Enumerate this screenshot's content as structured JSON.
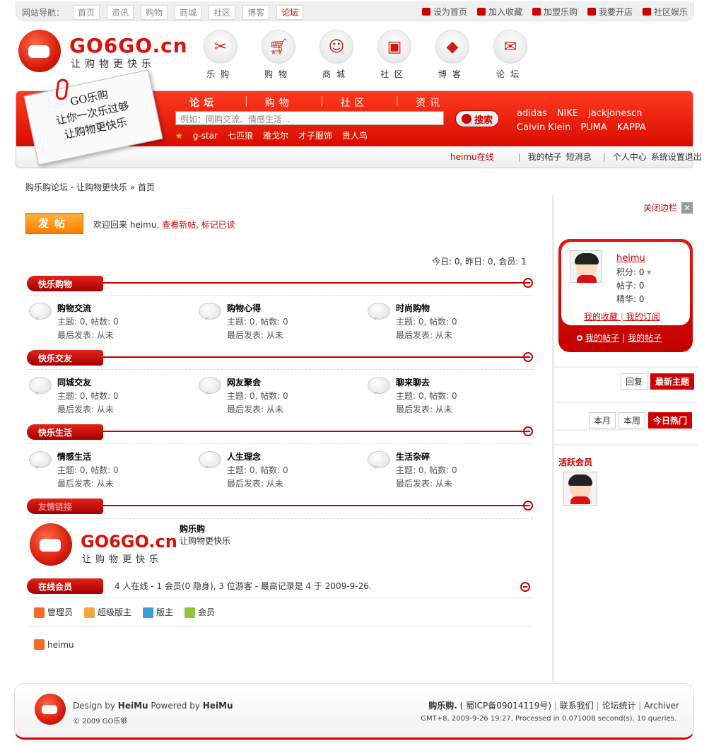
{
  "topbar": {
    "label": "网站导航：",
    "nav": [
      "首页",
      "资讯",
      "购物",
      "商城",
      "社区",
      "博客",
      "论坛"
    ],
    "active_index": 6,
    "quick": [
      "设为首页",
      "加入收藏",
      "加盟乐购",
      "我要开店",
      "社区娱乐"
    ]
  },
  "logo": {
    "text": "GO6GO.cn",
    "slogan": "让购物更快乐"
  },
  "main_icons": [
    {
      "label": "乐购",
      "icon": "scissors-icon"
    },
    {
      "label": "购物",
      "icon": "cart-icon"
    },
    {
      "label": "商城",
      "icon": "headset-icon"
    },
    {
      "label": "社区",
      "icon": "tv-icon"
    },
    {
      "label": "博客",
      "icon": "tag-icon"
    },
    {
      "label": "论坛",
      "icon": "chat-icon"
    }
  ],
  "note": {
    "line1": "GO乐购",
    "line2": "让你一次乐过够",
    "line3": "让购物更快乐"
  },
  "banner": {
    "tabs": [
      "论坛",
      "购物",
      "社区",
      "资讯"
    ],
    "search_placeholder": "例如：网购交流、情感生活...",
    "search_button": "搜索",
    "hot_words": [
      "g-star",
      "七匹狼",
      "雅戈尔",
      "才子服饰",
      "贵人鸟"
    ],
    "brands_row1": [
      "adidas",
      "NIKE",
      "jackjonescn"
    ],
    "brands_row2": [
      "Calvin Klein",
      "PUMA",
      "KAPPA"
    ]
  },
  "userbar": {
    "username": "heimu在线",
    "items1": [
      "我的帖子",
      "短消息"
    ],
    "items2": [
      "个人中心",
      "系统设置",
      "退出"
    ]
  },
  "breadcrumb": {
    "site": "购乐购论坛 - 让购物更快乐",
    "sep": "»",
    "current": "首页"
  },
  "post_button": "发帖",
  "welcome": {
    "prefix": "欢迎回来",
    "user": "heimu,",
    "link1": "查看新帖",
    "sep": ",",
    "link2": "标记已读"
  },
  "stats": "今日: 0, 昨日: 0, 会员: 1",
  "categories": [
    {
      "name": "快乐购物",
      "forums": [
        {
          "name": "购物交流",
          "stats": "主题: 0, 帖数: 0",
          "last": "最后发表: 从未"
        },
        {
          "name": "购物心得",
          "stats": "主题: 0, 帖数: 0",
          "last": "最后发表: 从未"
        },
        {
          "name": "时尚购物",
          "stats": "主题: 0, 帖数: 0",
          "last": "最后发表: 从未"
        }
      ]
    },
    {
      "name": "快乐交友",
      "forums": [
        {
          "name": "同城交友",
          "stats": "主题: 0, 帖数: 0",
          "last": "最后发表: 从未"
        },
        {
          "name": "网友聚会",
          "stats": "主题: 0, 帖数: 0",
          "last": "最后发表: 从未"
        },
        {
          "name": "聊来聊去",
          "stats": "主题: 0, 帖数: 0",
          "last": "最后发表: 从未"
        }
      ]
    },
    {
      "name": "快乐生活",
      "forums": [
        {
          "name": "情感生活",
          "stats": "主题: 0, 帖数: 0",
          "last": "最后发表: 从未"
        },
        {
          "name": "人生理念",
          "stats": "主题: 0, 帖数: 0",
          "last": "最后发表: 从未"
        },
        {
          "name": "生活杂碎",
          "stats": "主题: 0, 帖数: 0",
          "last": "最后发表: 从未"
        }
      ]
    }
  ],
  "friend_links": {
    "title": "友情链接",
    "logo_text": "GO6GO.cn",
    "logo_slogan": "让购物更快乐",
    "name": "购乐购",
    "desc": "让购物更快乐"
  },
  "online": {
    "title": "在线会员",
    "summary": "4 人在线 - 1 会员(0 隐身), 3 位游客 - 最高记录是 4 于 2009-9-26.",
    "legend": [
      "管理员",
      "超级版主",
      "版主",
      "会员"
    ],
    "users": [
      "heimu"
    ]
  },
  "sidebar": {
    "close": "关闭边栏",
    "profile": {
      "name": "heimu",
      "points": "积分: 0",
      "posts": "帖子: 0",
      "essence": "精华: 0",
      "link1": "我的收藏",
      "link2": "我的订阅",
      "post1": "我的帖子",
      "post2": "我的帖子"
    },
    "tabs1": [
      "回复",
      "最新主题"
    ],
    "tabs2": [
      "本月",
      "本周",
      "今日热门"
    ],
    "active_title": "活跃会员"
  },
  "footer": {
    "design": "Design by",
    "designer": "HeiMu",
    "powered": "Powered by",
    "powerer": "HeiMu",
    "copyright": "© 2009 GO乐够",
    "site": "购乐购.",
    "icp": "( 蜀ICP备09014119号)",
    "links": [
      "联系我们",
      "论坛统计",
      "Archiver"
    ],
    "processed": "GMT+8, 2009-9-26 19:27, Processed in 0.071008 second(s), 10 queries."
  }
}
